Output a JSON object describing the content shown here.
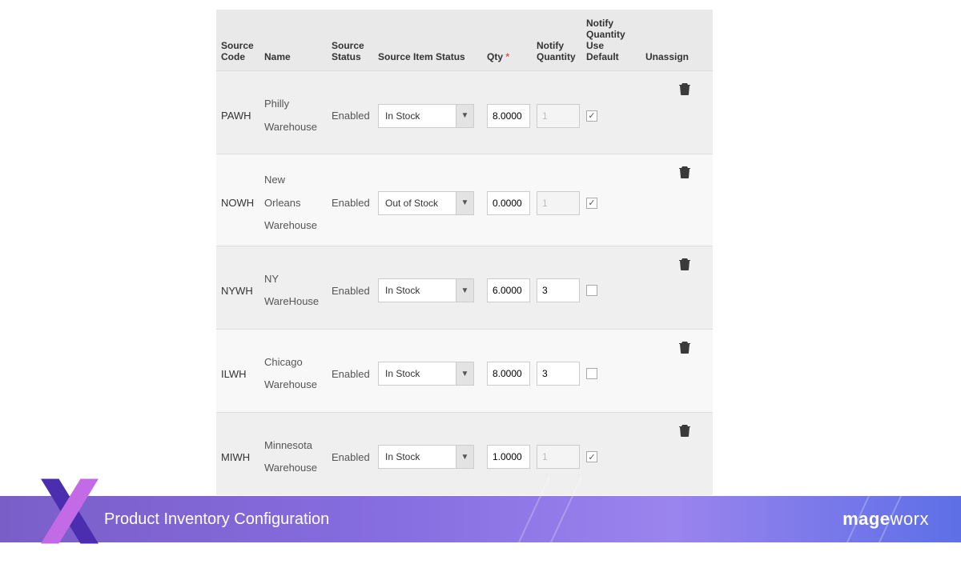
{
  "headers": {
    "code": "Source Code",
    "name": "Name",
    "status": "Source Status",
    "item": "Source Item Status",
    "qty": "Qty",
    "qty_required": "*",
    "notify": "Notify Quantity",
    "def": "Notify Quantity Use Default",
    "unassign": "Unassign"
  },
  "rows": [
    {
      "code": "PAWH",
      "name1": "Philly",
      "name2": "Warehouse",
      "status": "Enabled",
      "item": "In Stock",
      "qty": "8.0000",
      "notify": "1",
      "notify_disabled": true,
      "use_default": true
    },
    {
      "code": "NOWH",
      "name1": "New Orleans",
      "name2": "Warehouse",
      "status": "Enabled",
      "item": "Out of Stock",
      "qty": "0.0000",
      "notify": "1",
      "notify_disabled": true,
      "use_default": true
    },
    {
      "code": "NYWH",
      "name1": "NY",
      "name2": "WareHouse",
      "status": "Enabled",
      "item": "In Stock",
      "qty": "6.0000",
      "notify": "3",
      "notify_disabled": false,
      "use_default": false
    },
    {
      "code": "ILWH",
      "name1": "Chicago",
      "name2": "Warehouse",
      "status": "Enabled",
      "item": "In Stock",
      "qty": "8.0000",
      "notify": "3",
      "notify_disabled": false,
      "use_default": false
    },
    {
      "code": "MIWH",
      "name1": "Minnesota",
      "name2": "Warehouse",
      "status": "Enabled",
      "item": "In Stock",
      "qty": "1.0000",
      "notify": "1",
      "notify_disabled": true,
      "use_default": true
    }
  ],
  "footer": {
    "title": "Product Inventory Configuration",
    "brand_bold": "mage",
    "brand_rest": "worx"
  }
}
